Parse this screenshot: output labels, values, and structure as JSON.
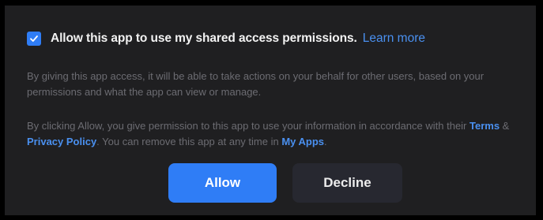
{
  "consent": {
    "checkbox_checked": true,
    "text": "Allow this app to use my shared access permissions.",
    "learn_more": "Learn more"
  },
  "description": {
    "text": "By giving this app access, it will be able to take actions on your behalf for other users, based on your permissions and what the app can view or manage."
  },
  "legal": {
    "part1": "By clicking Allow, you give permission to this app to use your information in accordance with their ",
    "terms_link": "Terms",
    "part2": " & ",
    "privacy_link": "Privacy Policy",
    "part3": ". You can remove this app at any time in ",
    "myapps_link": "My Apps",
    "part4": "."
  },
  "buttons": {
    "allow": "Allow",
    "decline": "Decline"
  },
  "colors": {
    "accent": "#2f7df6",
    "link": "#4a90f0",
    "panel_bg": "#1f1f21",
    "muted_text": "#6c6c72"
  },
  "icons": {
    "checkbox": "checkmark-icon"
  }
}
